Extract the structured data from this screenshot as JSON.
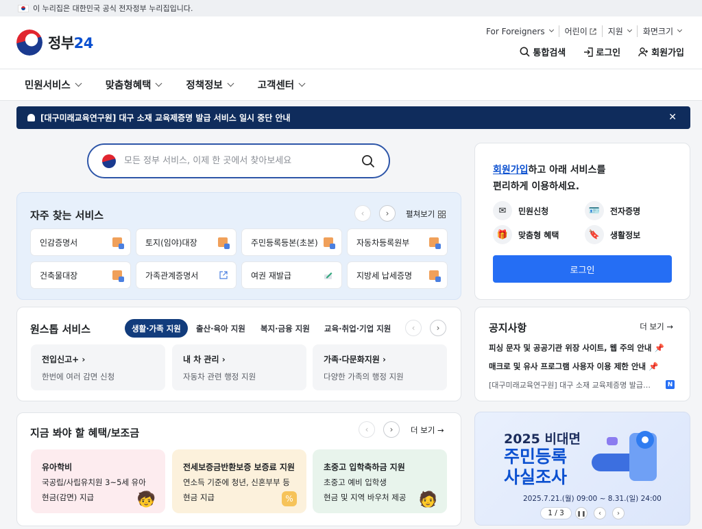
{
  "topbar": {
    "text": "이 누리집은 대한민국 공식 전자정부 누리집입니다."
  },
  "header": {
    "logo_text": "정부",
    "logo_num": "24",
    "util": [
      "For Foreigners",
      "어린이",
      "지원",
      "화면크기"
    ],
    "actions": [
      "통합검색",
      "로그인",
      "회원가입"
    ]
  },
  "nav": [
    "민원서비스",
    "맞춤형혜택",
    "정책정보",
    "고객센터"
  ],
  "notice_bar": {
    "text": "[대구미래교육연구원] 대구 소재 교육제증명 발급 서비스 일시 중단 안내"
  },
  "search": {
    "placeholder": "모든 정부 서비스, 이제 한 곳에서 찾아보세요"
  },
  "freq": {
    "title": "자주 찾는 서비스",
    "expand": "펼쳐보기",
    "items": [
      "인감증명서",
      "토지(임야)대장",
      "주민등록등본(초본)",
      "자동차등록원부",
      "건축물대장",
      "가족관계증명서",
      "여권 재발급",
      "지방세 납세증명"
    ]
  },
  "onestop": {
    "title": "원스톱 서비스",
    "tabs": [
      "생활·가족 지원",
      "출산·육아 지원",
      "복지·금융 지원",
      "교육·취업·기업 지원"
    ],
    "tiles": [
      {
        "title": "전입신고+",
        "desc": "한번에 여러 감면 신청"
      },
      {
        "title": "내 차 관리",
        "desc": "자동차 관련 행정 지원"
      },
      {
        "title": "가족·다문화지원",
        "desc": "다양한 가족의 행정 지원"
      }
    ]
  },
  "benefit": {
    "title": "지금 봐야 할 혜택/보조금",
    "more": "더 보기",
    "tiles": [
      {
        "title": "유아학비",
        "l1": "국공립/사립유치원 3~5세 유아",
        "l2": "현금(감면) 지급"
      },
      {
        "title": "전세보증금반환보증 보증료 지원",
        "l1": "연소득 기준에 청년, 신혼부부 등",
        "l2": "현금 지급"
      },
      {
        "title": "초중고 입학축하금 지원",
        "l1": "초중고 예비 입학생",
        "l2": "현금 및 지역 바우처 제공"
      }
    ]
  },
  "login_card": {
    "link": "회원가입",
    "line1": "하고 아래 서비스를",
    "line2": "편리하게 이용하세요.",
    "services": [
      "민원신청",
      "전자증명",
      "맞춤형 혜택",
      "생활정보"
    ],
    "button": "로그인"
  },
  "notice_card": {
    "title": "공지사항",
    "more": "더 보기",
    "items": [
      "피싱 문자 및 공공기관 위장 사이트, 웹 주의 안내",
      "매크로 및 유사 프로그램 사용자 이용 제한 안내",
      "[대구미래교육연구원] 대구 소재 교육제증명 발급…"
    ],
    "new_badge": "N"
  },
  "banner": {
    "l1": "2025 비대면",
    "l2": "주민등록",
    "l3": "사실조사",
    "date": "2025.7.21.(월) 09:00 ~ 8.31.(일) 24:00",
    "page": "1 / 3"
  },
  "colors": {
    "primary": "#256ef4",
    "navy": "#0f2c5c",
    "link": "#0b50d0"
  }
}
